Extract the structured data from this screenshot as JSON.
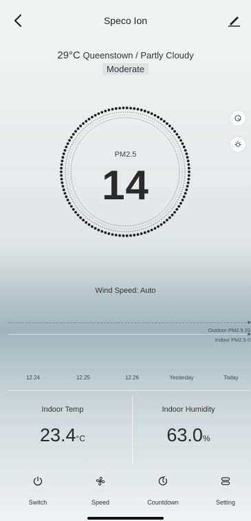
{
  "header": {
    "title": "Speco Ion",
    "back_icon": "chevron-left-icon",
    "edit_icon": "pencil-icon"
  },
  "weather": {
    "temperature": "29°C",
    "description": "Queenstown / Partly Cloudy",
    "air_quality": "Moderate"
  },
  "pm25": {
    "label": "PM2.5",
    "value": "14"
  },
  "side_buttons": [
    {
      "icon": "air-quality-icon"
    },
    {
      "icon": "light-icon"
    }
  ],
  "wind": {
    "text": "Wind Speed: Auto"
  },
  "chart": {
    "outdoor_legend": "Outdoor PM2.5 20",
    "indoor_legend": "Indoor PM2.5 0",
    "x_labels": [
      "12.24",
      "12.25",
      "12.26",
      "Yesterday",
      "Today"
    ]
  },
  "chart_data": {
    "type": "line",
    "categories": [
      "12.24",
      "12.25",
      "12.26",
      "Yesterday",
      "Today"
    ],
    "series": [
      {
        "name": "Outdoor PM2.5",
        "values": [
          20,
          20,
          20,
          20,
          20
        ]
      },
      {
        "name": "Indoor PM2.5",
        "values": [
          0,
          0,
          0,
          0,
          0
        ]
      }
    ]
  },
  "readings": {
    "temp": {
      "label": "Indoor Temp",
      "value": "23.4",
      "unit": "°C"
    },
    "humidity": {
      "label": "Indoor Humidity",
      "value": "63.0",
      "unit": "%"
    }
  },
  "controls": [
    {
      "label": "Switch",
      "icon": "power-icon"
    },
    {
      "label": "Speed",
      "icon": "fan-icon"
    },
    {
      "label": "Countdown",
      "icon": "timer-icon"
    },
    {
      "label": "Setting",
      "icon": "settings-icon"
    }
  ],
  "colors": {
    "text": "#2f2f2f",
    "sea": "#9fb5bb",
    "ring_dots": "#1f1f1f"
  }
}
